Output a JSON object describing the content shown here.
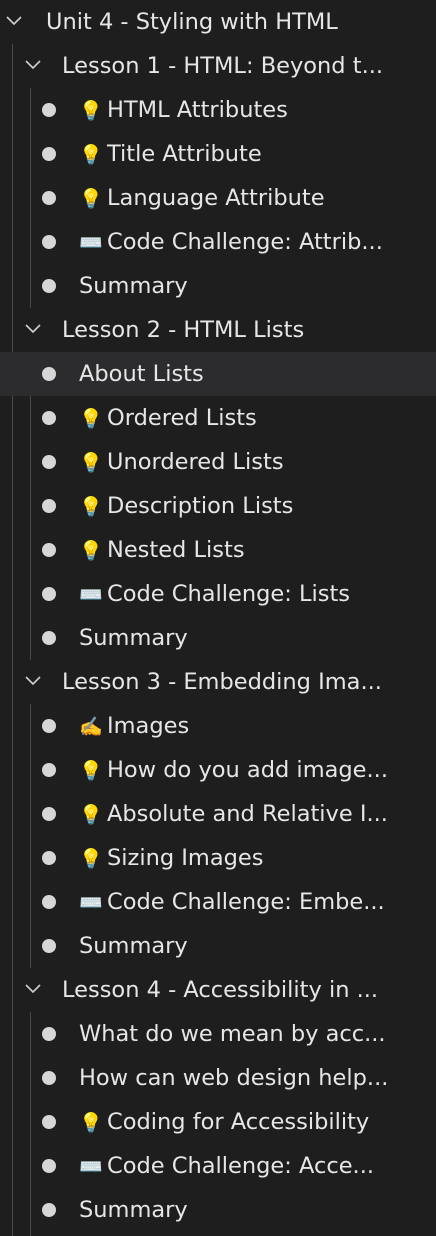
{
  "unit": {
    "title": "Unit 4 - Styling with HTML"
  },
  "lessons": [
    {
      "title": "Lesson 1 - HTML: Beyond t...",
      "items": [
        {
          "icon": "💡",
          "label": "HTML Attributes"
        },
        {
          "icon": "💡",
          "label": "Title Attribute"
        },
        {
          "icon": "💡",
          "label": "Language Attribute"
        },
        {
          "icon": "⌨️",
          "label": "Code Challenge: Attrib..."
        },
        {
          "icon": "",
          "label": "Summary"
        }
      ]
    },
    {
      "title": "Lesson 2 - HTML Lists",
      "items": [
        {
          "icon": "",
          "label": "About Lists",
          "selected": true
        },
        {
          "icon": "💡",
          "label": "Ordered Lists"
        },
        {
          "icon": "💡",
          "label": "Unordered Lists"
        },
        {
          "icon": "💡",
          "label": "Description Lists"
        },
        {
          "icon": "💡",
          "label": "Nested Lists"
        },
        {
          "icon": "⌨️",
          "label": "Code Challenge: Lists"
        },
        {
          "icon": "",
          "label": "Summary"
        }
      ]
    },
    {
      "title": "Lesson 3 - Embedding Ima...",
      "items": [
        {
          "icon": "✍️",
          "label": "Images"
        },
        {
          "icon": "💡",
          "label": "How do you add image..."
        },
        {
          "icon": "💡",
          "label": "Absolute and Relative I..."
        },
        {
          "icon": "💡",
          "label": "Sizing Images"
        },
        {
          "icon": "⌨️",
          "label": "Code Challenge: Embe..."
        },
        {
          "icon": "",
          "label": "Summary"
        }
      ]
    },
    {
      "title": "Lesson 4 - Accessibility in ...",
      "items": [
        {
          "icon": "",
          "label": "What do we mean by acc..."
        },
        {
          "icon": "",
          "label": "How can web design help..."
        },
        {
          "icon": "💡",
          "label": "Coding for Accessibility"
        },
        {
          "icon": "⌨️",
          "label": "Code Challenge: Acce..."
        },
        {
          "icon": "",
          "label": "Summary"
        }
      ]
    }
  ],
  "colors": {
    "background": "#1e1e1f",
    "selected_row": "#2c2c2e",
    "text": "#e6e6e6",
    "bullet": "#d6d6d6",
    "guide": "#4a4a4c"
  }
}
